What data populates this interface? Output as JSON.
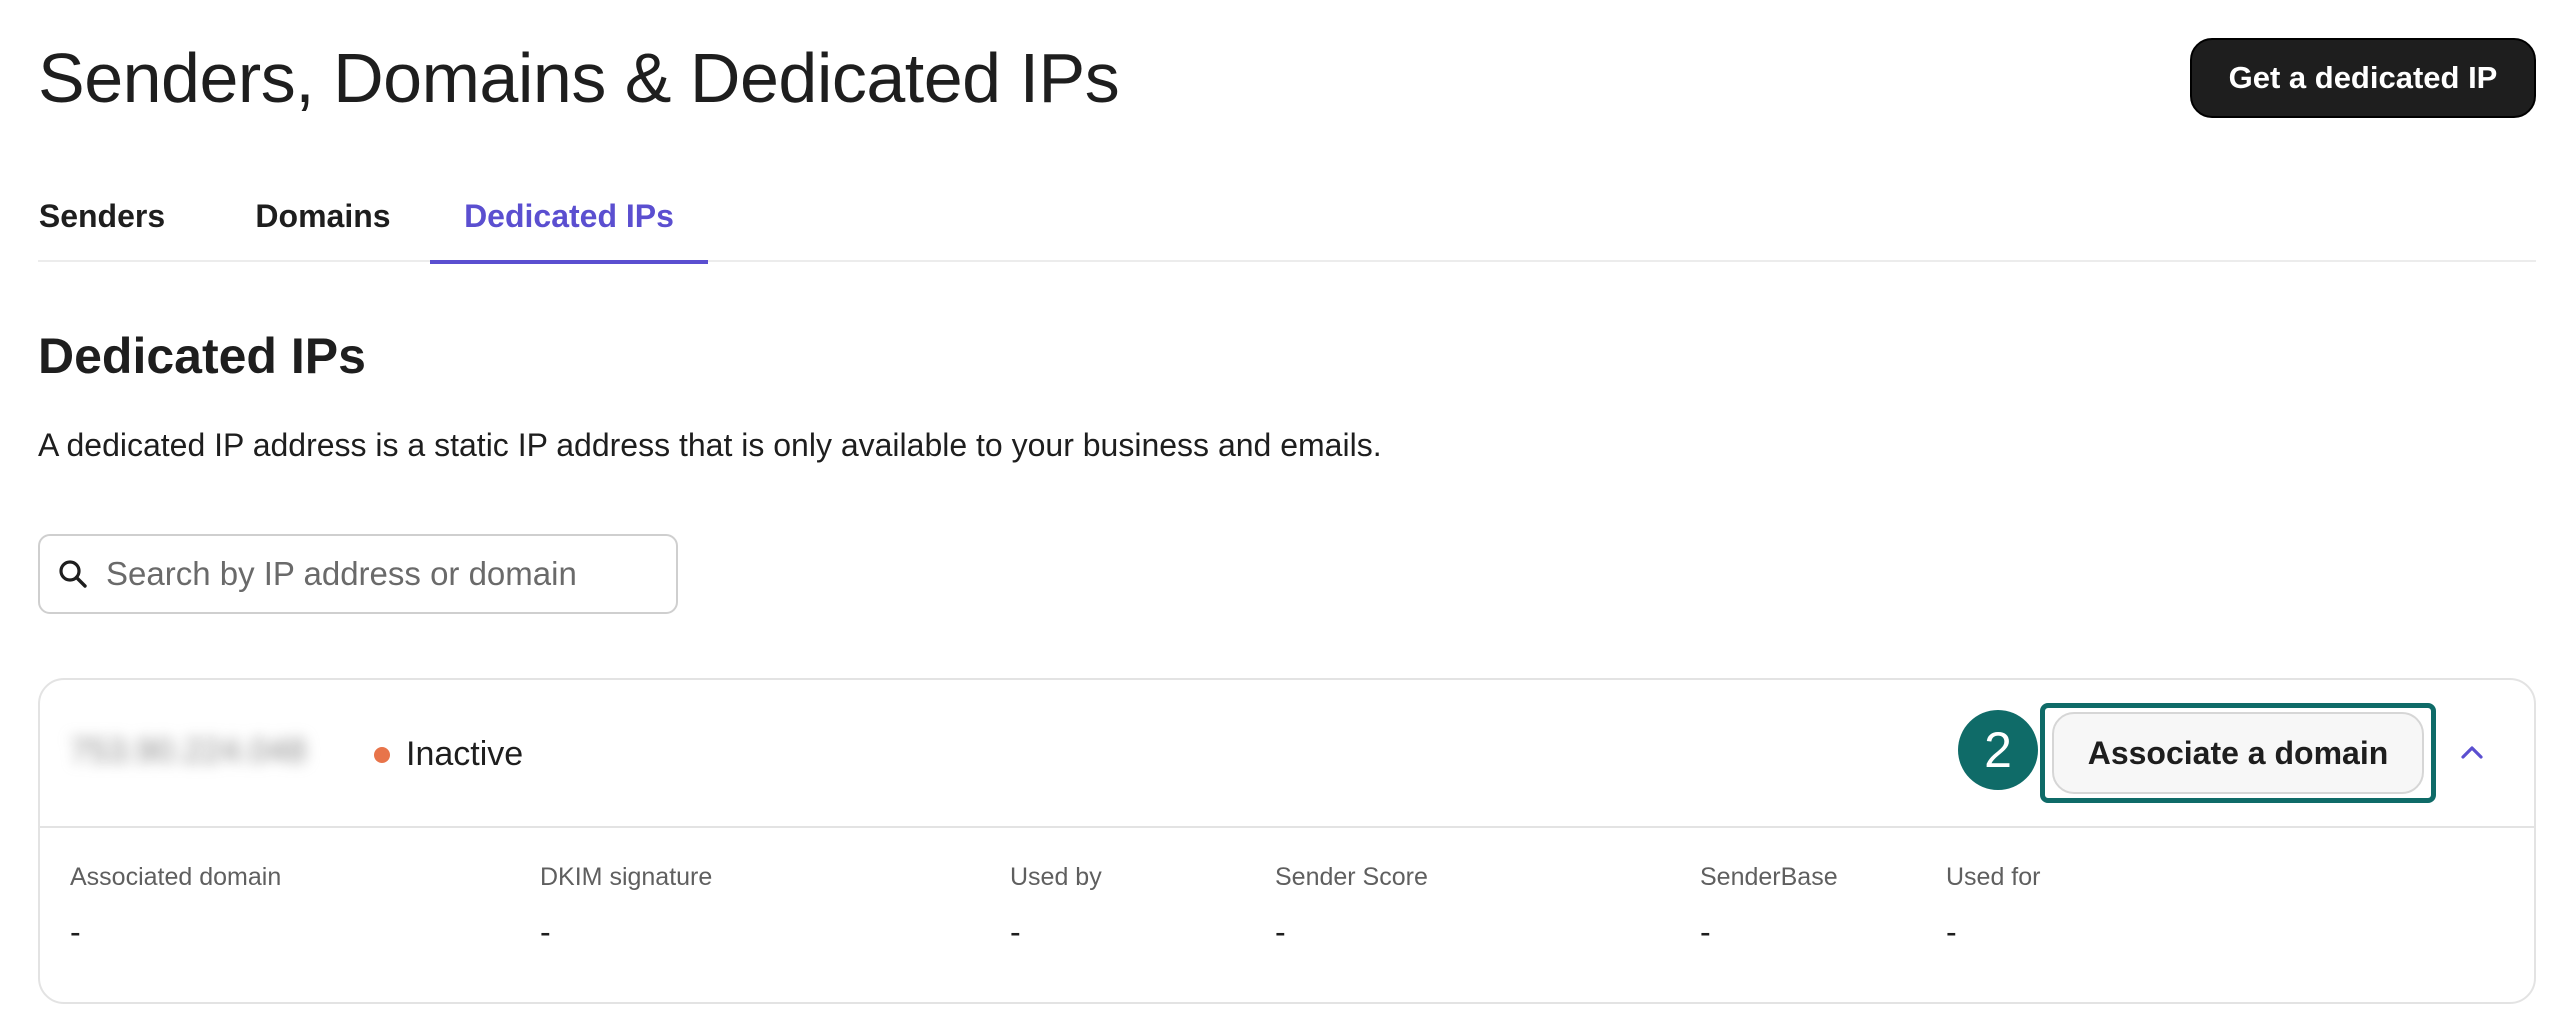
{
  "header": {
    "title": "Senders, Domains & Dedicated IPs",
    "cta_label": "Get a dedicated IP"
  },
  "tabs": [
    {
      "label": "Senders",
      "active": false
    },
    {
      "label": "Domains",
      "active": false
    },
    {
      "label": "Dedicated IPs",
      "active": true
    }
  ],
  "section": {
    "title": "Dedicated IPs",
    "description": "A dedicated IP address is a static IP address that is only available to your business and emails."
  },
  "search": {
    "placeholder": "Search by IP address or domain",
    "value": "",
    "icon": "search-icon"
  },
  "ip_card": {
    "ip_address": "753.90.224.048",
    "status": "Inactive",
    "status_color": "#e8744a",
    "step_marker": "2",
    "associate_label": "Associate a domain",
    "toggle_icon": "chevron-up-icon",
    "details": [
      {
        "label": "Associated domain",
        "value": "-"
      },
      {
        "label": "DKIM signature",
        "value": "-"
      },
      {
        "label": "Used by",
        "value": "-"
      },
      {
        "label": "Sender Score",
        "value": "-"
      },
      {
        "label": "SenderBase",
        "value": "-"
      },
      {
        "label": "Used for",
        "value": "-"
      }
    ]
  },
  "colors": {
    "accent": "#5b4fd0",
    "highlight": "#0f6b68",
    "primary_button": "#1e1e1e"
  }
}
